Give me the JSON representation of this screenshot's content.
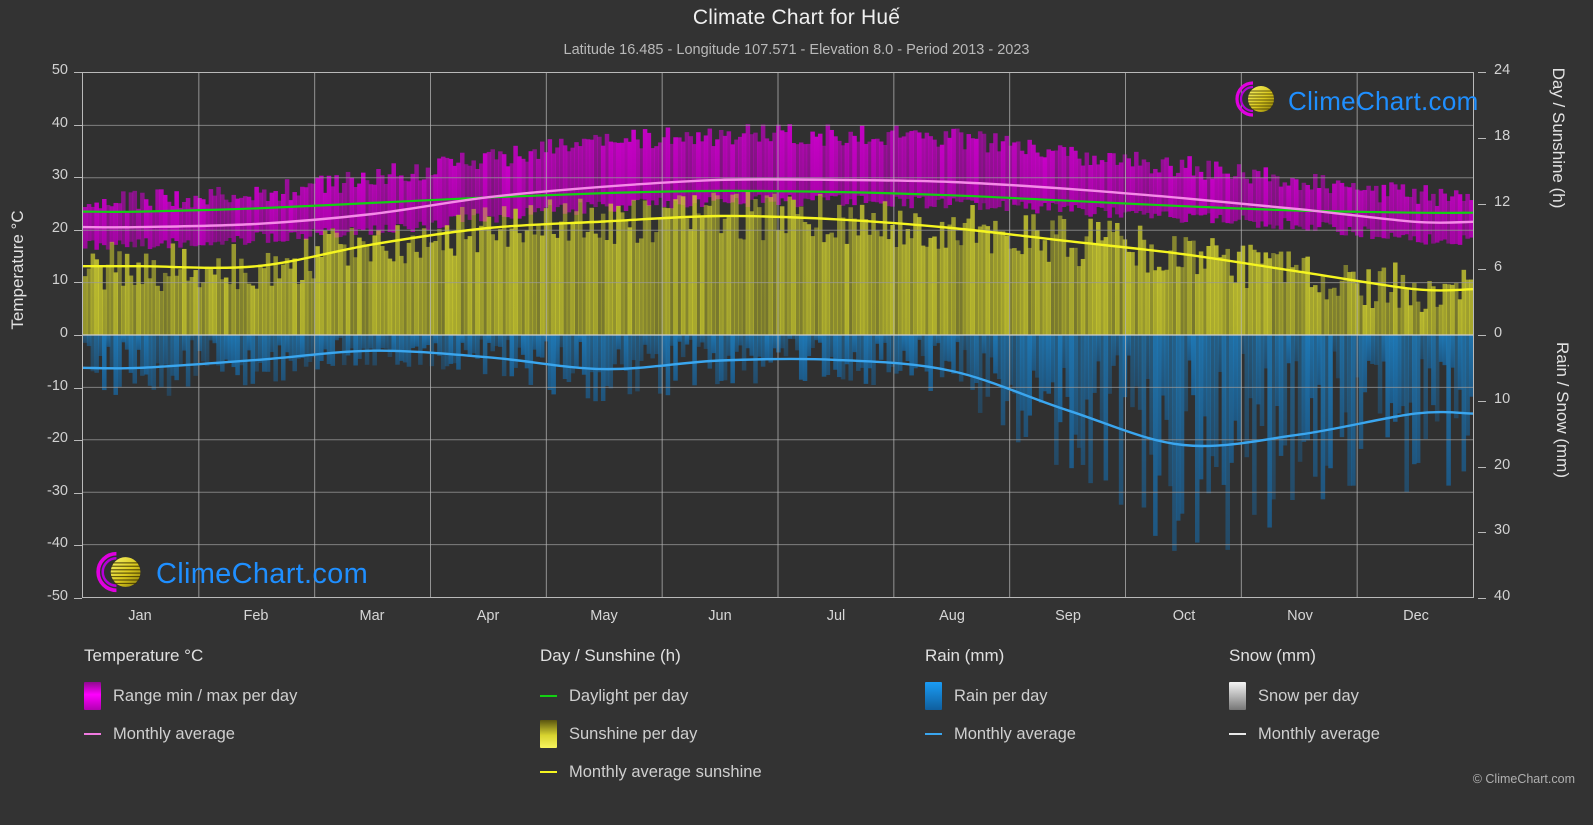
{
  "header": {
    "title": "Climate Chart for Huế",
    "subtitle": "Latitude 16.485 - Longitude 107.571 - Elevation 8.0 - Period 2013 - 2023"
  },
  "watermark": {
    "text": "ClimeChart.com",
    "copyright": "© ClimeChart.com"
  },
  "axes": {
    "left_title": "Temperature °C",
    "right_top_title": "Day / Sunshine (h)",
    "right_bottom_title": "Rain / Snow (mm)",
    "left_ticks": [
      "50",
      "40",
      "30",
      "20",
      "10",
      "0",
      "-10",
      "-20",
      "-30",
      "-40",
      "-50"
    ],
    "right_ticks": [
      "24",
      "18",
      "12",
      "6",
      "0",
      "10",
      "20",
      "30",
      "40"
    ],
    "x_ticks": [
      "Jan",
      "Feb",
      "Mar",
      "Apr",
      "May",
      "Jun",
      "Jul",
      "Aug",
      "Sep",
      "Oct",
      "Nov",
      "Dec"
    ]
  },
  "legend": {
    "columns": [
      {
        "title": "Temperature °C",
        "items": [
          {
            "label": "Range min / max per day",
            "type": "swatch",
            "color": "#e000e0"
          },
          {
            "label": "Monthly average",
            "type": "line",
            "color": "#f07ae0"
          }
        ]
      },
      {
        "title": "Day / Sunshine (h)",
        "items": [
          {
            "label": "Daylight per day",
            "type": "line",
            "color": "#12d012"
          },
          {
            "label": "Sunshine per day",
            "type": "swatch",
            "color": "#f2ef4a"
          },
          {
            "label": "Monthly average sunshine",
            "type": "line",
            "color": "#f5f520"
          }
        ]
      },
      {
        "title": "Rain (mm)",
        "items": [
          {
            "label": "Rain per day",
            "type": "swatch",
            "color": "#1090e8"
          },
          {
            "label": "Monthly average",
            "type": "line",
            "color": "#3aa6ef"
          }
        ]
      },
      {
        "title": "Snow (mm)",
        "items": [
          {
            "label": "Snow per day",
            "type": "swatch",
            "color": "#e8e8e8"
          },
          {
            "label": "Monthly average",
            "type": "line",
            "color": "#e8e8e8"
          }
        ]
      }
    ]
  },
  "colors": {
    "background": "#333333",
    "plot_background": "#303030",
    "grid": "#9a9a9a",
    "frame": "#b9b9b9",
    "temp_range": "#d000d0",
    "temp_avg_line": "#f58be8",
    "daylight_line": "#12d012",
    "sunshine_band": "#c8c828",
    "sunshine_line": "#f5f520",
    "rain_band": "#1c6aa8",
    "rain_line": "#3aa6ef",
    "text": "#d6d6d6",
    "watermark_text": "#1f8fff"
  },
  "chart_data": {
    "type": "area",
    "title": "Climate Chart for Huế",
    "subtitle": "Latitude 16.485 - Longitude 107.571 - Elevation 8.0 - Period 2013 - 2023",
    "xlabel": "",
    "ylabel": "Temperature °C",
    "y2label_top": "Day / Sunshine (h)",
    "y2label_bottom": "Rain / Snow (mm)",
    "grid": true,
    "legend_position": "below",
    "categories": [
      "Jan",
      "Feb",
      "Mar",
      "Apr",
      "May",
      "Jun",
      "Jul",
      "Aug",
      "Sep",
      "Oct",
      "Nov",
      "Dec"
    ],
    "ylim_temperature_c": [
      -50,
      50
    ],
    "ylim_day_sunshine_h": [
      0,
      24
    ],
    "ylim_rain_snow_mm": [
      0,
      40
    ],
    "note_axis_mapping": "Upper half (0..50 °C) maps to 0..24 h; lower half (0..-50 °C) maps to 0..40 mm (inverted)",
    "series": [
      {
        "name": "Monthly average temperature",
        "unit": "°C",
        "color": "#f58be8",
        "values": [
          20.6,
          21.2,
          23.1,
          26.3,
          28.3,
          29.6,
          29.6,
          29.2,
          27.9,
          26.1,
          24.0,
          21.6
        ]
      },
      {
        "name": "Daily max temperature (range top)",
        "unit": "°C",
        "color": "#d000d0",
        "values": [
          25.0,
          26.5,
          29.5,
          33.0,
          36.0,
          37.5,
          37.5,
          36.8,
          34.0,
          31.5,
          29.0,
          26.0
        ]
      },
      {
        "name": "Daily min temperature (range bottom)",
        "unit": "°C",
        "color": "#d000d0",
        "values": [
          17.5,
          18.5,
          20.0,
          22.5,
          24.5,
          25.5,
          25.5,
          25.2,
          24.0,
          22.5,
          21.0,
          18.5
        ]
      },
      {
        "name": "Daylight per day",
        "unit": "h",
        "color": "#12d012",
        "values": [
          11.3,
          11.6,
          12.1,
          12.6,
          13.0,
          13.2,
          13.1,
          12.8,
          12.3,
          11.8,
          11.4,
          11.2
        ]
      },
      {
        "name": "Monthly average sunshine",
        "unit": "h",
        "color": "#f5f520",
        "values": [
          6.3,
          6.3,
          8.3,
          9.8,
          10.4,
          10.9,
          10.6,
          9.8,
          8.6,
          7.4,
          5.8,
          4.2
        ]
      },
      {
        "name": "Rain monthly average",
        "unit": "mm",
        "color": "#3aa6ef",
        "values": [
          5.0,
          3.8,
          2.4,
          3.4,
          5.2,
          3.9,
          3.8,
          5.5,
          11.5,
          16.8,
          15.2,
          12.0
        ]
      },
      {
        "name": "Snow monthly average",
        "unit": "mm",
        "color": "#e8e8e8",
        "values": [
          0,
          0,
          0,
          0,
          0,
          0,
          0,
          0,
          0,
          0,
          0,
          0
        ]
      }
    ]
  }
}
